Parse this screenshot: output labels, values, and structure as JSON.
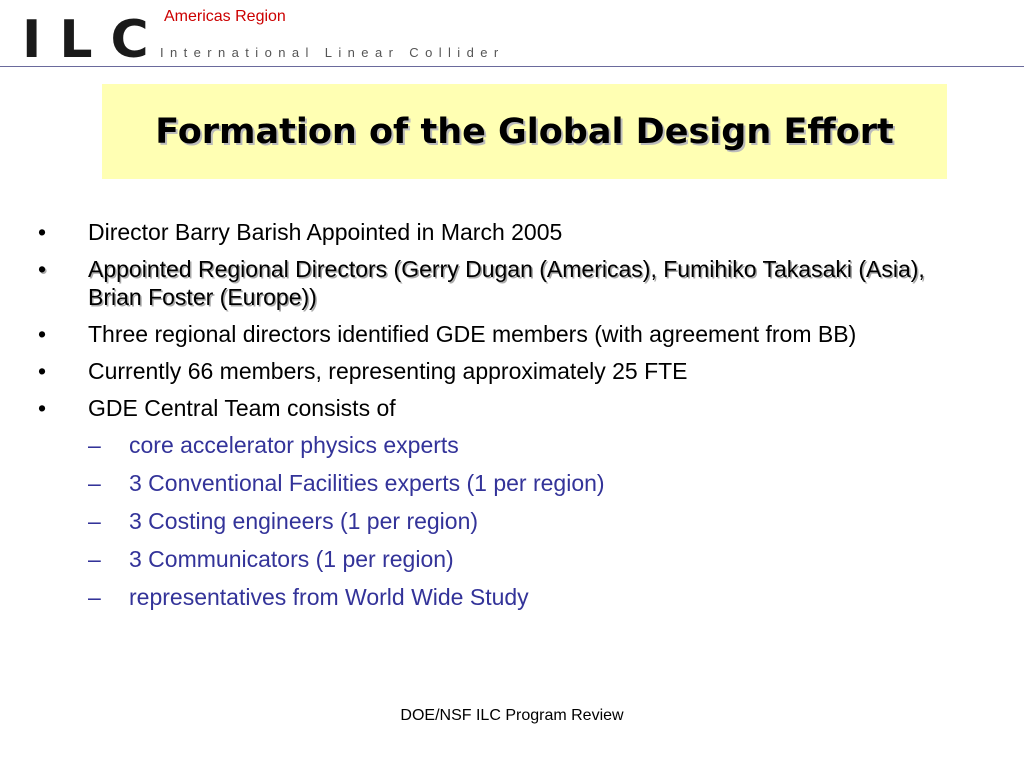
{
  "header": {
    "logo": "ILC",
    "region": "Americas Region",
    "subtitle": "International Linear Collider"
  },
  "slide": {
    "title": "Formation of the Global Design Effort",
    "bullets": [
      {
        "level": 1,
        "marker": "•",
        "text": "Director Barry Barish Appointed in March 2005"
      },
      {
        "level": 1,
        "marker": "•",
        "text": "Appointed Regional Directors (Gerry Dugan  (Americas), Fumihiko Takasaki (Asia), Brian Foster (Europe))"
      },
      {
        "level": 1,
        "marker": "•",
        "text": "Three regional directors identified GDE members (with agreement from BB)"
      },
      {
        "level": 1,
        "marker": "•",
        "text": "Currently 66 members, representing approximately 25 FTE"
      },
      {
        "level": 1,
        "marker": "•",
        "text": "GDE Central Team consists of"
      },
      {
        "level": 2,
        "marker": "–",
        "text": "core accelerator physics experts"
      },
      {
        "level": 2,
        "marker": "–",
        "text": "3 Conventional Facilities experts (1 per region)"
      },
      {
        "level": 2,
        "marker": "–",
        "text": "3 Costing engineers (1 per region)"
      },
      {
        "level": 2,
        "marker": "–",
        "text": "3 Communicators (1 per region)"
      },
      {
        "level": 2,
        "marker": "–",
        "text": "representatives from World Wide Study"
      }
    ]
  },
  "footer": {
    "text": "DOE/NSF ILC Program Review"
  },
  "colors": {
    "title_bg": "#ffffb3",
    "region_text": "#cc0000",
    "sub_bullet_text": "#333399",
    "header_rule": "#6a6a9c"
  }
}
